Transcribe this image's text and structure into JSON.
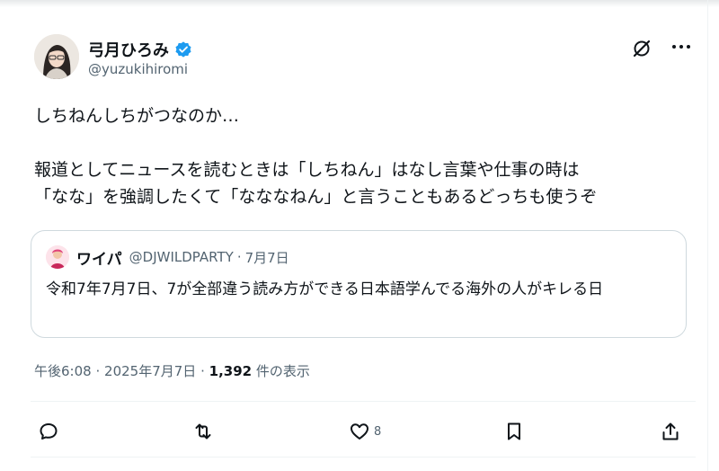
{
  "author": {
    "display_name": "弓月ひろみ",
    "handle": "@yuzukihiromi",
    "verified": true
  },
  "tweet": {
    "lines_first": [
      "しちねんしちがつなのか…"
    ],
    "lines_second": [
      "報道としてニュースを読むときは「しちねん」はなし言葉や仕事の時は",
      "「なな」を強調したくて「なななねん」と言うこともあるどっちも使うぞ"
    ]
  },
  "quote": {
    "display_name": "ワイパ",
    "handle": "@DJWILDPARTY",
    "separator": "·",
    "date": "7月7日",
    "body": "令和7年7月7日、7が全部違う読み方ができる日本語学んでる海外の人がキレる日"
  },
  "meta": {
    "time": "午後6:08",
    "sep1": "·",
    "date": "2025年7月7日",
    "sep2": "·",
    "views_count": "1,392",
    "views_label": "件の表示"
  },
  "actions": {
    "reply_icon": "reply-icon",
    "repost_icon": "repost-icon",
    "like_icon": "heart-icon",
    "like_count": "8",
    "bookmark_icon": "bookmark-icon",
    "share_icon": "share-icon"
  },
  "colors": {
    "text": "#0f1419",
    "secondary": "#536471",
    "verified_blue": "#1d9bf0",
    "border": "#cfd9de"
  }
}
